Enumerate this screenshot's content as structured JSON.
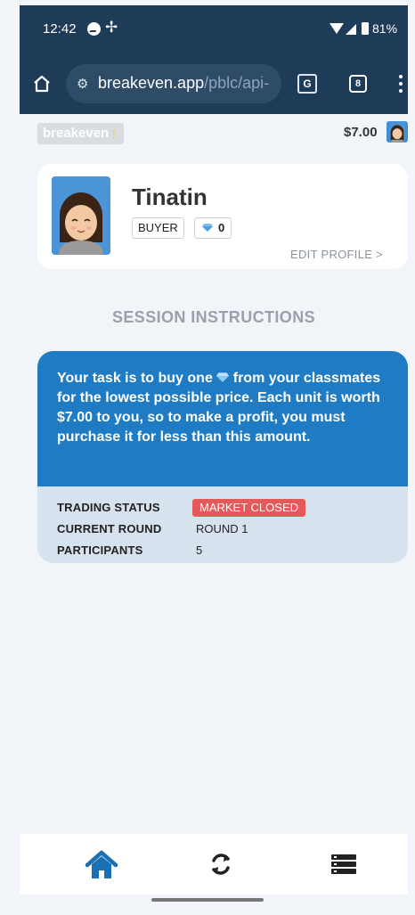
{
  "status_bar": {
    "time": "12:42",
    "battery": "81%"
  },
  "browser": {
    "url_domain": "breakeven.app",
    "url_path": "/pblc/api-",
    "tab_count": "8"
  },
  "app": {
    "logo": "breakeven",
    "balance": "$7.00"
  },
  "profile": {
    "name": "Tinatin",
    "role": "BUYER",
    "gem_count": "0",
    "edit_label": "EDIT PROFILE >"
  },
  "session": {
    "title": "SESSION INSTRUCTIONS",
    "instruction_part1": "Your task is to buy one",
    "instruction_part2": " from your classmates for the lowest possible price. Each unit is worth $7.00 to you, so to make a profit, you must purchase it for less than this amount.",
    "rows": [
      {
        "label": "TRADING STATUS",
        "value": "MARKET CLOSED"
      },
      {
        "label": "CURRENT ROUND",
        "value": "ROUND 1"
      },
      {
        "label": "PARTICIPANTS",
        "value": "5"
      }
    ]
  },
  "nav": {
    "items": [
      "home",
      "refresh",
      "list"
    ],
    "active": "home"
  },
  "colors": {
    "chrome": "#1e3b58",
    "accent": "#1f7cc4",
    "market_closed": "#e45a5a",
    "nav_active": "#1b6fb3"
  }
}
